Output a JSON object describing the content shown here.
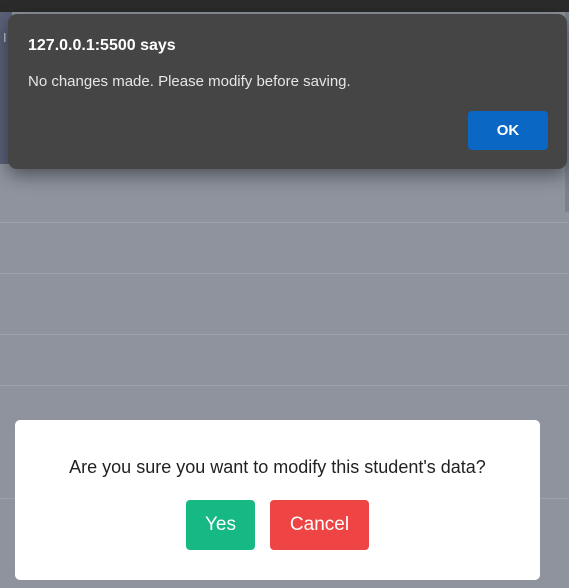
{
  "background_page": {
    "edge_char": "I"
  },
  "alert": {
    "title": "127.0.0.1:5500 says",
    "message": "No changes made. Please modify before saving.",
    "ok_label": "OK"
  },
  "confirm": {
    "message": "Are you sure you want to modify this student's data?",
    "yes_label": "Yes",
    "cancel_label": "Cancel"
  },
  "colors": {
    "overlay": "#8e939d",
    "alert_bg": "#454545",
    "ok_button": "#0a68c4",
    "yes_button": "#16b884",
    "cancel_button": "#ee4443"
  }
}
